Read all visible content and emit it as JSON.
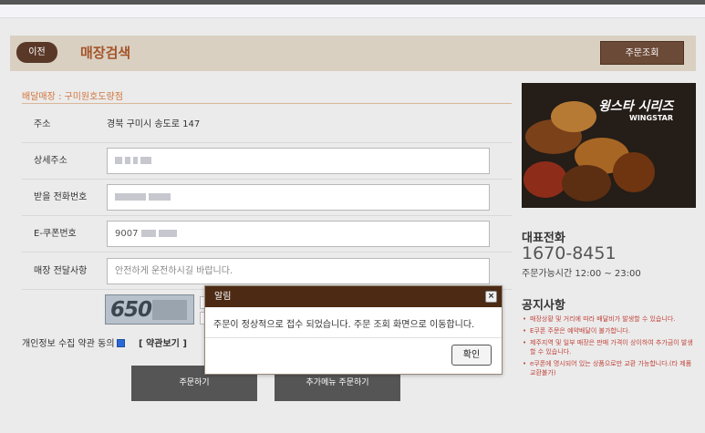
{
  "header": {
    "back_label": "이전",
    "title": "매장검색",
    "order_check_label": "주문조회"
  },
  "store": {
    "label": "배달매장 : 구미원호도량점"
  },
  "form": {
    "address_label": "주소",
    "address_value": "경북 구미시 송도로 147",
    "detail_address_label": "상세주소",
    "phone_label": "받을 전화번호",
    "ecoupon_label": "E-쿠폰번호",
    "ecoupon_value": "9007",
    "store_message_label": "매장 전달사항",
    "store_message_value": "안전하게 운전하시길 바랍니다."
  },
  "captcha": {
    "visible_text": "650"
  },
  "consent": {
    "label": "개인정보 수집 약관 동의",
    "checked": true,
    "terms_link": "[ 약관보기 ]"
  },
  "actions": {
    "order_label": "주문하기",
    "extra_order_label": "추가메뉴 주문하기"
  },
  "banner": {
    "title": "윙스타 시리즈",
    "subtitle": "WINGSTAR"
  },
  "sidebar": {
    "rep_phone_label": "대표전화",
    "rep_phone": "1670-8451",
    "hours": "주문가능시간 12:00 ~ 23:00",
    "notice_title": "공지사항",
    "notices": [
      "매장상황 및 거리에 따라 배달비가 발생할 수 있습니다.",
      "E쿠폰 주문은 예약배달이 불가합니다.",
      "제주지역 및 일부 매장은 판매 가격이 상이하여 추가금이 발생할 수 있습니다.",
      "e쿠폰에 명시되어 있는 상품으로만 교환 가능합니다.(타 제품 교환불가)"
    ]
  },
  "dialog": {
    "title": "알림",
    "close_glyph": "×",
    "message": "주문이 정상적으로 접수 되었습니다. 주문 조회 화면으로 이동합니다.",
    "ok_label": "확인"
  },
  "colors": {
    "header_bg": "#d9d0c1",
    "brand_brown": "#5a3828",
    "title_orange": "#a4542a",
    "dialog_head": "#4c2a14",
    "notice_red": "#c0433a"
  }
}
